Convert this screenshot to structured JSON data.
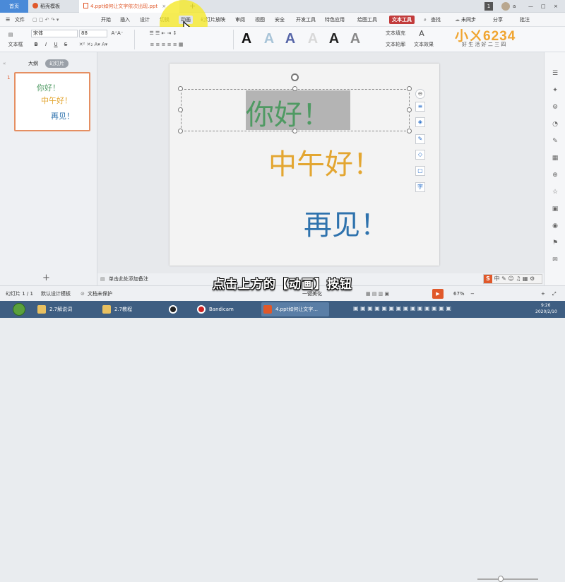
{
  "tabs": {
    "home": "首页",
    "template": "稻壳模板",
    "doc": "4.ppt如何让文字依次出现.ppt",
    "close": "×",
    "plus": "+"
  },
  "topbar_right": {
    "badge": "1",
    "user": "a"
  },
  "menu": {
    "file": "文件",
    "items": [
      "开始",
      "插入",
      "设计",
      "切换",
      "动画",
      "幻灯片放映",
      "审阅",
      "视图",
      "安全",
      "开发工具",
      "特色应用",
      "绘图工具",
      "文本工具"
    ],
    "search": "查找",
    "sync": "未同步",
    "share": "分享",
    "comment": "批注"
  },
  "ribbon": {
    "textbox": "文本框",
    "font": "宋体",
    "size": "88",
    "bold": "B",
    "italic": "I",
    "underline": "U",
    "strike": "S",
    "style_letter": "A",
    "text_fill": "文本填充",
    "text_outline": "文本轮廓",
    "text_effect": "文本效果"
  },
  "brand": {
    "logo": "小ㄨ6234",
    "tagline": "好 生 活 好 二 三 四"
  },
  "left_panel": {
    "outline_tab": "大纲",
    "slides_tab": "幻灯片",
    "slide_number": "1",
    "thumb_lines": [
      "你好！",
      "中午好！",
      "再见！"
    ],
    "add": "+"
  },
  "slide": {
    "line1": "你好！",
    "line2": "中午好！",
    "line3": "再见！",
    "color1": "#4f9a63",
    "color2": "#e3a631",
    "color3": "#2e72ad"
  },
  "float_tools": [
    "⊖",
    "≡",
    "◈",
    "✎",
    "◇",
    "▢",
    "字"
  ],
  "notes": {
    "placeholder": "单击此处添加备注"
  },
  "status": {
    "slide_count": "幻灯片 1 / 1",
    "template": "默认设计模板",
    "protect": "文档未保护",
    "beautify": "一键美化",
    "zoom": "67%"
  },
  "caption": "点击上方的【动画】按钮",
  "taskbar": {
    "items": [
      "2.7解说词",
      "2.7教程",
      "",
      "Bandicam",
      "4.ppt如何让文字..."
    ],
    "time": "9:26",
    "date": "2020/2/10"
  },
  "colors": {
    "accent": "#4a8ad8",
    "text_tool": "#c23b3b",
    "highlight": "#f5e829",
    "selection": "#b4b4b4"
  }
}
